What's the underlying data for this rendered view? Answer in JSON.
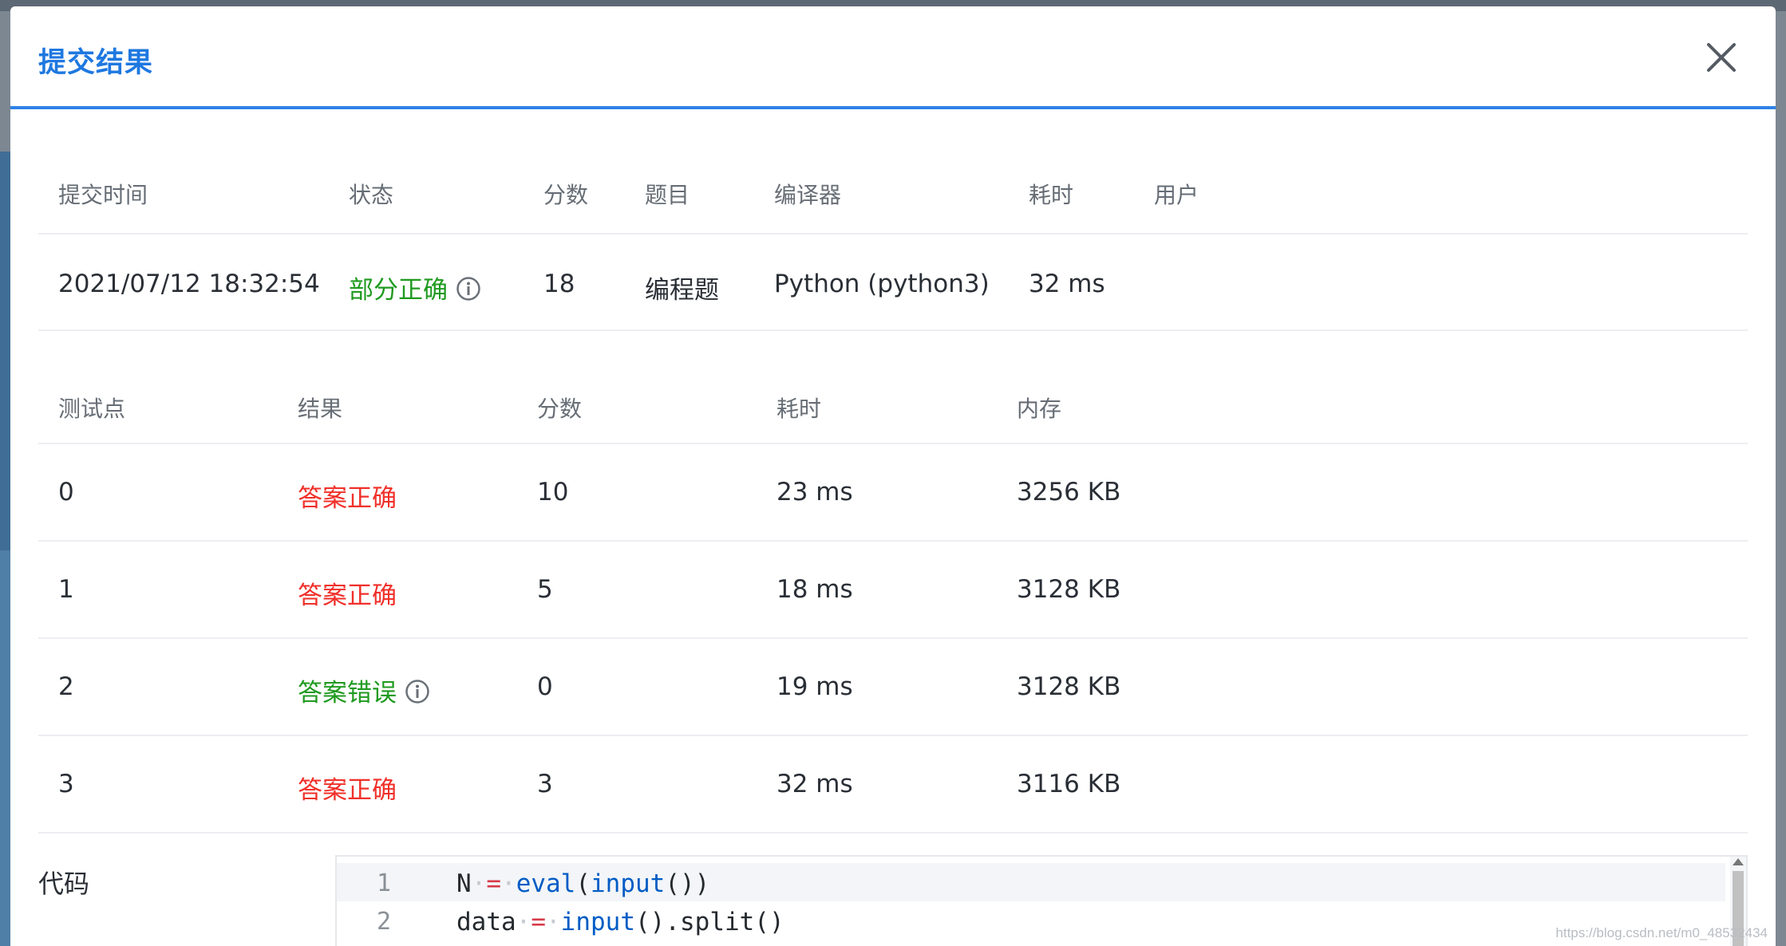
{
  "dialog": {
    "title": "提交结果"
  },
  "summary": {
    "headers": {
      "time": "提交时间",
      "status": "状态",
      "score": "分数",
      "problem": "题目",
      "compiler": "编译器",
      "time_cost": "耗时",
      "user": "用户"
    },
    "row": {
      "time": "2021/07/12 18:32:54",
      "status": "部分正确",
      "score": "18",
      "problem": "编程题",
      "compiler": "Python (python3)",
      "time_cost": "32 ms",
      "user": ""
    }
  },
  "testcases": {
    "headers": {
      "case": "测试点",
      "result": "结果",
      "score": "分数",
      "time_cost": "耗时",
      "memory": "内存"
    },
    "rows": [
      {
        "case": "0",
        "result": "答案正确",
        "score": "10",
        "time_cost": "23 ms",
        "memory": "3256 KB"
      },
      {
        "case": "1",
        "result": "答案正确",
        "score": "5",
        "time_cost": "18 ms",
        "memory": "3128 KB"
      },
      {
        "case": "2",
        "result": "答案错误",
        "score": "0",
        "time_cost": "19 ms",
        "memory": "3128 KB"
      },
      {
        "case": "3",
        "result": "答案正确",
        "score": "3",
        "time_cost": "32 ms",
        "memory": "3116 KB"
      }
    ]
  },
  "code": {
    "label": "代码",
    "lines": [
      {
        "no": "1",
        "t1": "N",
        "op": "=",
        "fn": "eval",
        "p1": "(",
        "fn2": "input",
        "p2": "())"
      },
      {
        "no": "2",
        "t1": "data",
        "op": "=",
        "fn": "input",
        "rest": "().split()"
      }
    ]
  },
  "watermark": "https://blog.csdn.net/m0_48532434",
  "colors": {
    "accent": "#2f83e6",
    "title": "#1e78e0",
    "correct": "#f0302a",
    "wrong": "#1f9a1f",
    "partial": "#1f9a1f"
  },
  "icons": {
    "close": "close-icon",
    "info": "info-icon"
  }
}
